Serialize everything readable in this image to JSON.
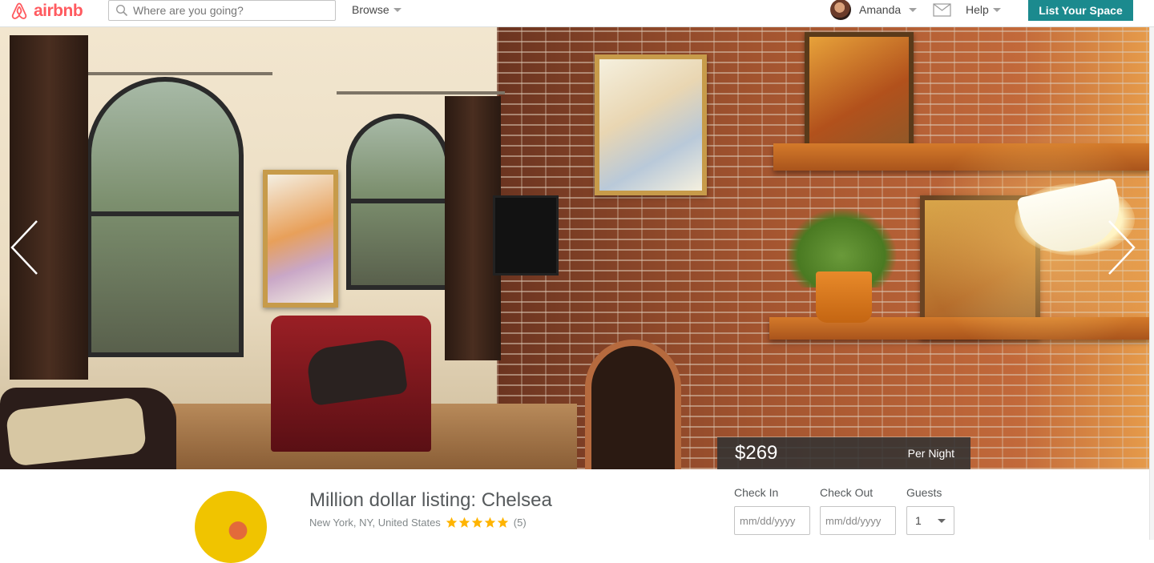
{
  "header": {
    "logo_text": "airbnb",
    "search_placeholder": "Where are you going?",
    "browse_label": "Browse",
    "user_name": "Amanda",
    "help_label": "Help",
    "list_space_label": "List Your Space",
    "brand_color": "#ff5a5f",
    "accent_color": "#1b8a8e"
  },
  "hero": {
    "price": "$269",
    "price_unit": "Per Night",
    "icons": [
      "chevron-left-icon",
      "chevron-right-icon"
    ]
  },
  "listing": {
    "title": "Million dollar listing: Chelsea",
    "location": "New York, NY, United States",
    "rating": 5,
    "rating_max": 5,
    "review_count": "(5)",
    "star_color": "#ffb400"
  },
  "booking": {
    "check_in_label": "Check In",
    "check_out_label": "Check Out",
    "guests_label": "Guests",
    "check_in_placeholder": "mm/dd/yyyy",
    "check_out_placeholder": "mm/dd/yyyy",
    "guests_value": "1"
  }
}
